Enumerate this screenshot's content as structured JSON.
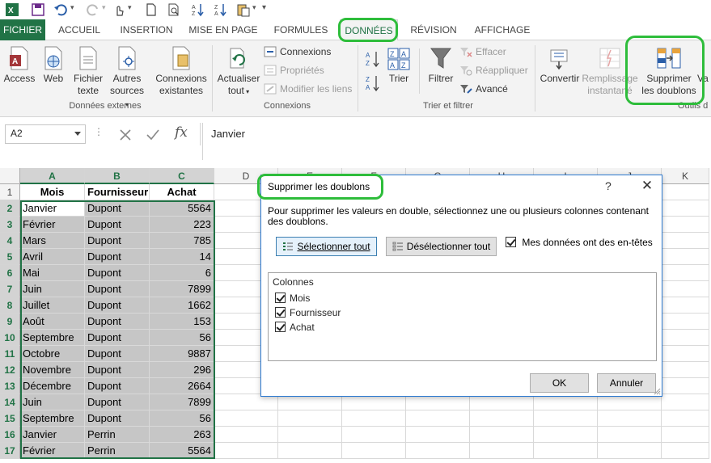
{
  "tabs": {
    "file": "FICHIER",
    "items": [
      "ACCUEIL",
      "INSERTION",
      "MISE EN PAGE",
      "FORMULES",
      "DONNÉES",
      "RÉVISION",
      "AFFICHAGE"
    ]
  },
  "ribbon": {
    "external": {
      "access": "Access",
      "web": "Web",
      "text_file_1": "Fichier",
      "text_file_2": "texte",
      "other_1": "Autres",
      "other_2": "sources",
      "existing_1": "Connexions",
      "existing_2": "existantes",
      "group": "Données externes"
    },
    "connections": {
      "refresh_1": "Actualiser",
      "refresh_2": "tout",
      "connexions": "Connexions",
      "properties": "Propriétés",
      "edit_links": "Modifier les liens",
      "group": "Connexions"
    },
    "sort": {
      "sort": "Trier",
      "filter": "Filtrer",
      "clear": "Effacer",
      "reapply": "Réappliquer",
      "advanced": "Avancé",
      "group": "Trier et filtrer"
    },
    "tools": {
      "convert": "Convertir",
      "flash_1": "Remplissage",
      "flash_2": "instantané",
      "remove_1": "Supprimer",
      "remove_2": "les doublons",
      "partial": "Va",
      "group_partial": "Outils d"
    }
  },
  "formula_bar": {
    "name_box": "A2",
    "fx": "fx",
    "value": "Janvier"
  },
  "grid": {
    "columns": [
      "A",
      "B",
      "C",
      "D",
      "E",
      "F",
      "G",
      "H",
      "I",
      "J",
      "K"
    ],
    "rows": [
      "1",
      "2",
      "3",
      "4",
      "5",
      "6",
      "7",
      "8",
      "9",
      "10",
      "11",
      "12",
      "13",
      "14",
      "15",
      "16",
      "17"
    ],
    "headers": [
      "Mois",
      "Fournisseur",
      "Achat"
    ],
    "data": [
      [
        "Janvier",
        "Dupont",
        "5564"
      ],
      [
        "Février",
        "Dupont",
        "223"
      ],
      [
        "Mars",
        "Dupont",
        "785"
      ],
      [
        "Avril",
        "Dupont",
        "14"
      ],
      [
        "Mai",
        "Dupont",
        "6"
      ],
      [
        "Juin",
        "Dupont",
        "7899"
      ],
      [
        "Juillet",
        "Dupont",
        "1662"
      ],
      [
        "Août",
        "Dupont",
        "153"
      ],
      [
        "Septembre",
        "Dupont",
        "56"
      ],
      [
        "Octobre",
        "Dupont",
        "9887"
      ],
      [
        "Novembre",
        "Dupont",
        "296"
      ],
      [
        "Décembre",
        "Dupont",
        "2664"
      ],
      [
        "Juin",
        "Dupont",
        "7899"
      ],
      [
        "Septembre",
        "Dupont",
        "56"
      ],
      [
        "Janvier",
        "Perrin",
        "263"
      ],
      [
        "Février",
        "Perrin",
        "5564"
      ]
    ]
  },
  "dialog": {
    "title": "Supprimer les doublons",
    "help": "?",
    "close": "✕",
    "description": "Pour supprimer les valeurs en double, sélectionnez une ou plusieurs colonnes contenant des doublons.",
    "select_all": "Sélectionner tout",
    "deselect_all": "Désélectionner tout",
    "has_headers": "Mes données ont des en-têtes",
    "columns_label": "Colonnes",
    "columns": [
      "Mois",
      "Fournisseur",
      "Achat"
    ],
    "ok": "OK",
    "cancel": "Annuler"
  },
  "colors": {
    "excel_green": "#217346",
    "highlight": "#2ebd3b",
    "selection_fill": "#c6c6c6"
  }
}
